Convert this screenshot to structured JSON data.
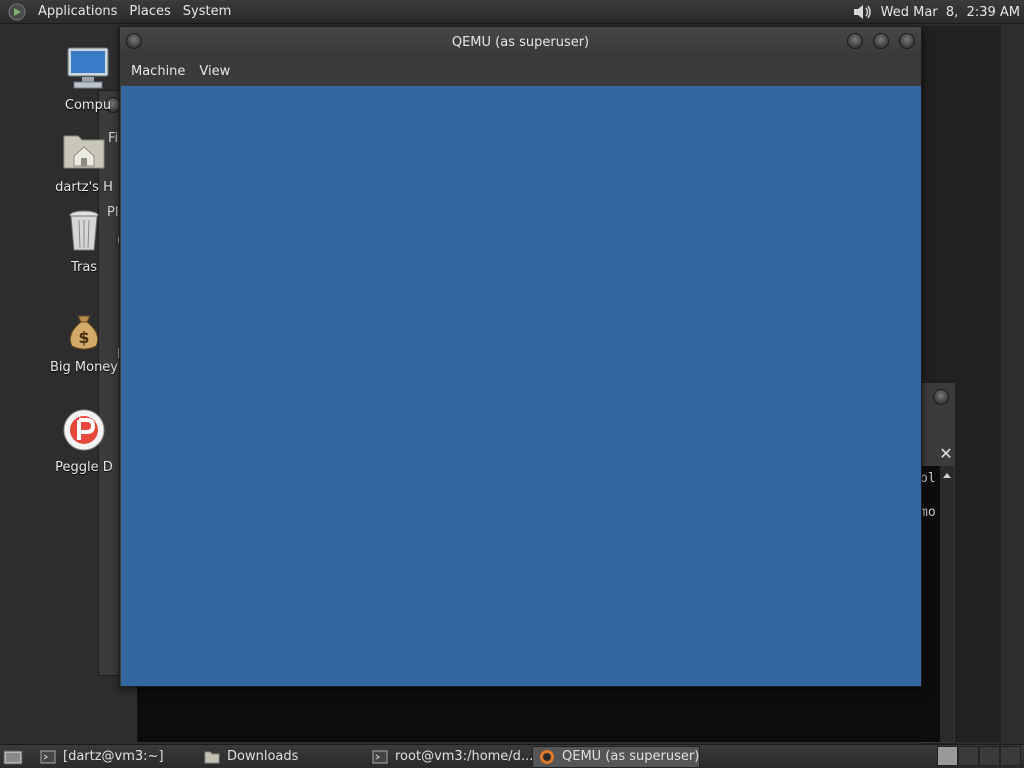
{
  "top_panel": {
    "menus": [
      "Applications",
      "Places",
      "System"
    ],
    "clock": "Wed Mar  8,  2:39 AM",
    "logo_icon": "gnome-foot-icon",
    "volume_icon": "speaker-icon"
  },
  "desktop": {
    "icons": [
      {
        "label": "Compu",
        "icon": "computer-icon"
      },
      {
        "label": "dartz's H",
        "icon": "home-folder-icon"
      },
      {
        "label": "Tras",
        "icon": "trash-icon"
      },
      {
        "label": "Big Money",
        "icon": "money-bag-icon"
      },
      {
        "label": "Peggle D",
        "icon": "peggle-icon"
      }
    ]
  },
  "background_windows": {
    "left_fragments": [
      "Fi",
      "Pl",
      "(",
      "I"
    ],
    "terminal_fragments": [
      "ol",
      "mo"
    ],
    "tab_close": "✕"
  },
  "qemu_window": {
    "title": "QEMU (as superuser)",
    "menus": [
      "Machine",
      "View"
    ],
    "screen_color": "#3367a0"
  },
  "bottom_panel": {
    "tasks": [
      {
        "label": "[dartz@vm3:~]",
        "icon": "terminal-icon",
        "active": false
      },
      {
        "label": "Downloads",
        "icon": "folder-icon",
        "active": false
      },
      {
        "label": "root@vm3:/home/d...",
        "icon": "terminal-icon",
        "active": false
      },
      {
        "label": "QEMU (as superuser)",
        "icon": "qemu-icon",
        "active": true
      }
    ],
    "workspaces": 4
  }
}
